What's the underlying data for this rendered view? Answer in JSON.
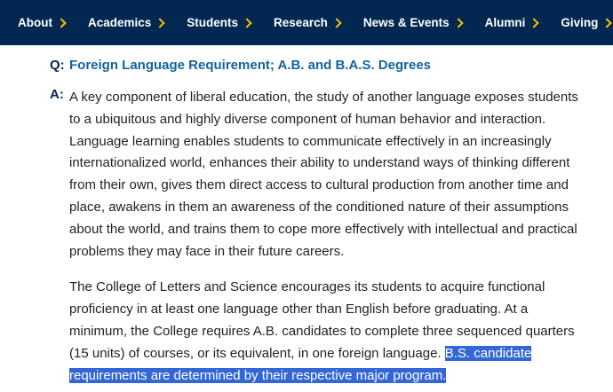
{
  "nav": {
    "items": [
      {
        "label": "About"
      },
      {
        "label": "Academics"
      },
      {
        "label": "Students"
      },
      {
        "label": "Research"
      },
      {
        "label": "News & Events"
      },
      {
        "label": "Alumni"
      },
      {
        "label": "Giving"
      }
    ]
  },
  "qa": {
    "q_marker": "Q:",
    "question": "Foreign Language Requirement; A.B. and B.A.S. Degrees",
    "a_marker": "A:",
    "paragraph1": "A key component of liberal education, the study of another language exposes students to a ubiquitous and highly diverse component of human behavior and interaction. Language learning enables students to communicate effectively in an increasingly internationalized world, enhances their ability to understand ways of thinking different from their own, gives them direct access to cultural production from another time and place, awakens in them an awareness of the conditioned nature of their assumptions about the world, and trains them to cope more effectively with intellectual and practical problems they may face in their future careers.",
    "paragraph2_plain": "The College of Letters and Science encourages its students to acquire functional proficiency in at least one language other than English before graduating. At a minimum, the College requires A.B. candidates to complete three sequenced quarters (15 units) of courses, or its equivalent, in one foreign language. ",
    "paragraph2_selected": "B.S. candidate requirements are determined by their respective major program."
  },
  "colors": {
    "nav_bg": "#022851",
    "chevron": "#FFBF00",
    "question_text": "#13639E",
    "selection_bg": "#3367D6"
  }
}
